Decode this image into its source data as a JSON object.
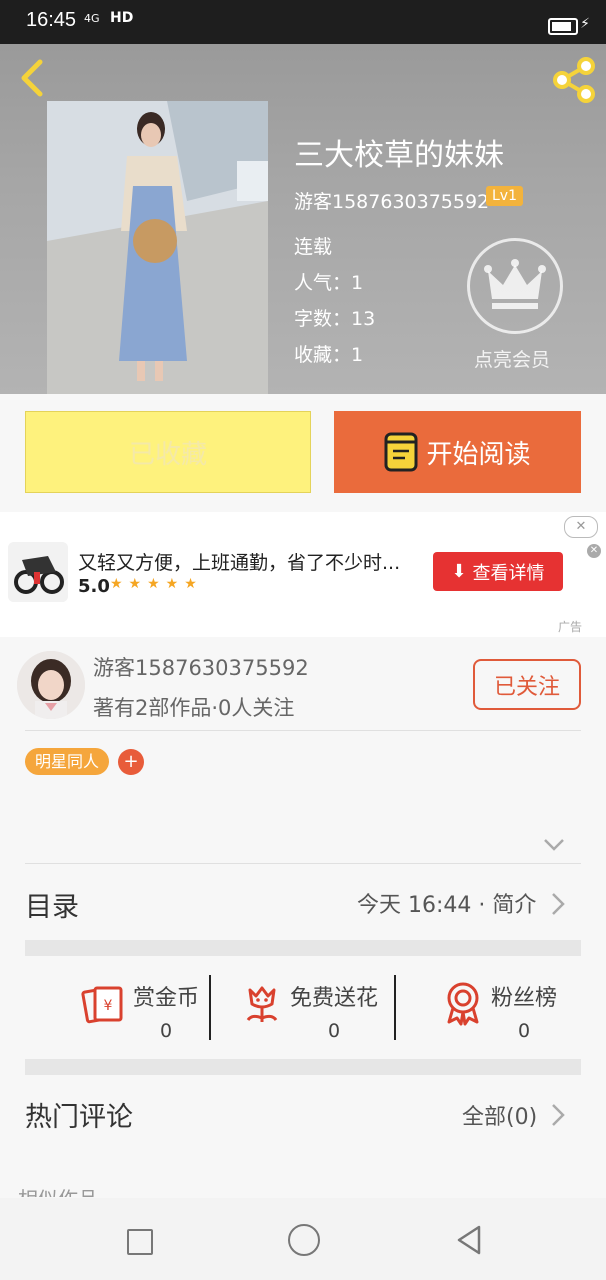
{
  "status_bar": {
    "time": "16:45",
    "network": "4G",
    "hd": "HD"
  },
  "book": {
    "title": "三大校草的妹妹",
    "author": "游客1587630375592",
    "level": "Lv1",
    "status": "连载",
    "popularity": "人气：1",
    "word_count": "字数：13",
    "favorites": "收藏：1",
    "vip_label": "点亮会员"
  },
  "actions": {
    "favorited_label": "已收藏",
    "read_label": "开始阅读"
  },
  "ad": {
    "text": "又轻又方便，上班通勤，省了不少时...",
    "rating": "5.0",
    "stars": "★★★★★",
    "button": "查看详情",
    "close": "✕",
    "label": "广告"
  },
  "author_card": {
    "name": "游客1587630375592",
    "stats": "著有2部作品·0人关注",
    "follow_label": "已关注",
    "tag": "明星同人",
    "tag_add": "+"
  },
  "toc": {
    "label": "目录",
    "updated": "今天 16:44 · 简介"
  },
  "stats": [
    {
      "label": "赏金币",
      "value": "0",
      "icon": "reward-envelope-icon"
    },
    {
      "label": "免费送花",
      "value": "0",
      "icon": "flower-icon"
    },
    {
      "label": "粉丝榜",
      "value": "0",
      "icon": "medal-icon"
    }
  ],
  "comments": {
    "label": "热门评论",
    "all": "全部(0)"
  },
  "similar": {
    "label": "相似作品"
  },
  "colors": {
    "accent_orange": "#ea6b3c",
    "fav_yellow": "#fef27d",
    "tag_orange": "#f5a63c",
    "icon_red": "#d9412e"
  }
}
